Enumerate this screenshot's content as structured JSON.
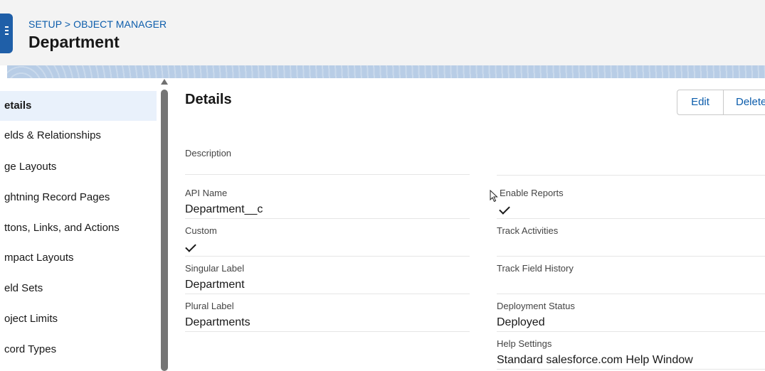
{
  "header": {
    "breadcrumb": "SETUP > OBJECT MANAGER",
    "title": "Department"
  },
  "sidebar": {
    "items": [
      {
        "label": "etails",
        "active": true
      },
      {
        "label": "elds & Relationships"
      },
      {
        "label": "ge Layouts"
      },
      {
        "label": "ghtning Record Pages"
      },
      {
        "label": "ttons, Links, and Actions"
      },
      {
        "label": "mpact Layouts"
      },
      {
        "label": "eld Sets"
      },
      {
        "label": "oject Limits"
      },
      {
        "label": "cord Types"
      }
    ]
  },
  "main": {
    "section_title": "Details",
    "buttons": {
      "edit": "Edit",
      "delete": "Delete"
    },
    "fields": {
      "description": {
        "label": "Description",
        "value": ""
      },
      "api_name": {
        "label": "API Name",
        "value": "Department__c"
      },
      "custom": {
        "label": "Custom",
        "checked": true
      },
      "singular_label": {
        "label": "Singular Label",
        "value": "Department"
      },
      "plural_label": {
        "label": "Plural Label",
        "value": "Departments"
      },
      "enable_reports": {
        "label": "Enable Reports",
        "checked": true
      },
      "track_activities": {
        "label": "Track Activities",
        "value": ""
      },
      "track_field_history": {
        "label": "Track Field History",
        "value": ""
      },
      "deployment_status": {
        "label": "Deployment Status",
        "value": "Deployed"
      },
      "help_settings": {
        "label": "Help Settings",
        "value": "Standard salesforce.com Help Window"
      }
    }
  },
  "colors": {
    "brand": "#1f5fa8",
    "link": "#0b5cab",
    "active_bg": "#e9f1fb"
  }
}
